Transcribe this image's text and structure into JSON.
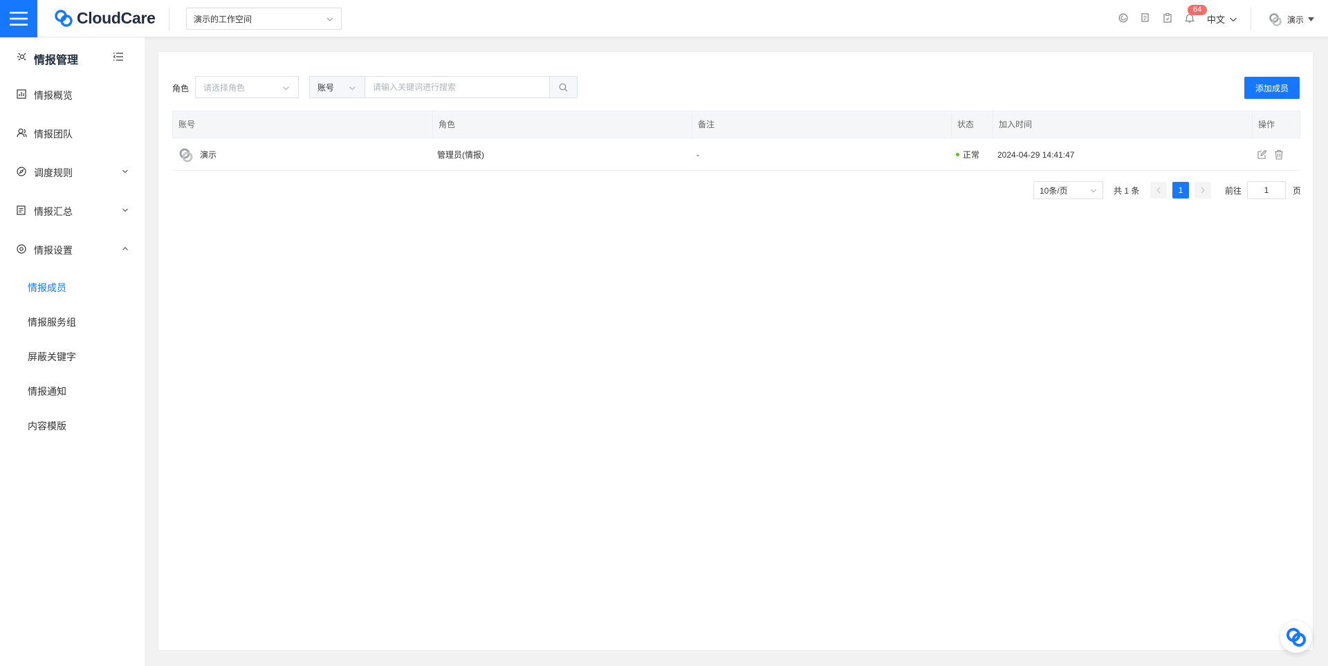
{
  "header": {
    "logo_text": "CloudCare",
    "workspace": "演示的工作空间",
    "notification_count": "64",
    "language": "中文",
    "user_name": "演示"
  },
  "sidebar": {
    "title": "情报管理",
    "items": [
      {
        "label": "情报概览",
        "icon": "chart-icon"
      },
      {
        "label": "情报团队",
        "icon": "team-icon"
      },
      {
        "label": "调度规则",
        "icon": "compass-icon"
      },
      {
        "label": "情报汇总",
        "icon": "document-icon"
      },
      {
        "label": "情报设置",
        "icon": "settings-icon"
      }
    ],
    "sub_items": [
      "情报成员",
      "情报服务组",
      "屏蔽关键字",
      "情报通知",
      "内容模版"
    ],
    "active_sub": "情报成员"
  },
  "filters": {
    "role_label": "角色",
    "role_placeholder": "请选择角色",
    "account_type": "账号",
    "search_placeholder": "请输入关键词进行搜索",
    "add_button": "添加成员"
  },
  "table": {
    "columns": [
      "账号",
      "角色",
      "备注",
      "状态",
      "加入时间",
      "操作"
    ],
    "rows": [
      {
        "account": "演示",
        "role": "管理员(情报)",
        "note": "-",
        "status": "正常",
        "joined": "2024-04-29 14:41:47"
      }
    ]
  },
  "pagination": {
    "page_size": "10条/页",
    "total": "共 1 条",
    "current_page": "1",
    "goto_label": "前往",
    "goto_value": "1",
    "page_suffix": "页"
  },
  "colors": {
    "primary": "#1677ff",
    "status_ok": "#52c41a",
    "badge": "#f56c6c"
  }
}
